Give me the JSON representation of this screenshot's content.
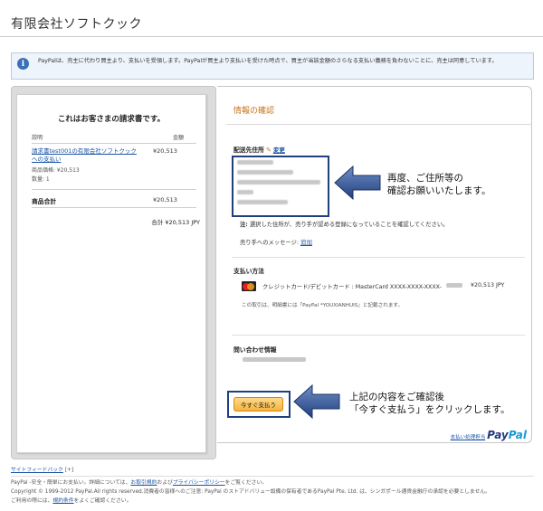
{
  "header": {
    "company": "有限会社ソフトクック"
  },
  "notice": {
    "icon": "info-icon",
    "text": "PayPalは、売主に代わり買主より、支払いを受領します。PayPalが買主より支払いを受けた時点で、買主が当該金額のさらなる支払い義務を負わないことに、売主は同意しています。"
  },
  "invoice": {
    "title": "これはお客さまの請求書です。",
    "col_desc": "説明",
    "col_amount": "金額",
    "item_name": "請求書test001の有限会社ソフトクックへの支払い",
    "item_price_label": "商品価格: ¥20,513",
    "item_qty": "数量: 1",
    "item_amount": "¥20,513",
    "subtotal_label": "商品合計",
    "subtotal_value": "¥20,513",
    "total": "合計 ¥20,513 JPY"
  },
  "main": {
    "section_title": "情報の確認",
    "shipping_label": "配送先住所",
    "change_link": "変更",
    "note_prefix": "注:",
    "note_text": "選択した住所が、売り手が認める登録になっていることを確認してください。",
    "message_label": "売り手へのメッセージ:",
    "message_link": "追加",
    "payment_label": "支払い方法",
    "card_text": "クレジットカード/デビットカード : MasterCard XXXX-XXXX-XXXX-",
    "card_amount": "¥20,513 JPY",
    "statement_note": "この取引は、明細書には「PayPal *YOUXIANHUIS」と記載されます。",
    "contact_label": "問い合わせ情報",
    "pay_button": "今すぐ支払う",
    "paypal_jp": "支払い処理担当",
    "paypal_pay": "Pay",
    "paypal_pal": "Pal"
  },
  "annotations": {
    "a1_line1": "再度、ご住所等の",
    "a1_line2": "確認お願いいたします。",
    "a2_line1": "上記の内容をご確認後",
    "a2_line2": "「今すぐ支払う」をクリックします。"
  },
  "footer": {
    "feedback": "サイトフィードバック",
    "feedback_mark": "[+]",
    "line1_pre": "PayPal -安全・簡単にお支払い。詳細については、",
    "line1_link1": "お取引規約",
    "line1_mid": "および",
    "line1_link2": "プライバシーポリシー",
    "line1_post": "をご覧ください。",
    "line2": "Copyright © 1999-2012 PayPal.All rights reserved.消費者の皆様へのご注意: PayPal のストアドバリュー設備の保有者であるPayPal Pte. Ltd. は、シンガポール通貨金融庁の承認を必要としません。",
    "line3_pre": "ご利用の際には、",
    "line3_link": "規約条件",
    "line3_post": "をよくご確認ください。"
  }
}
